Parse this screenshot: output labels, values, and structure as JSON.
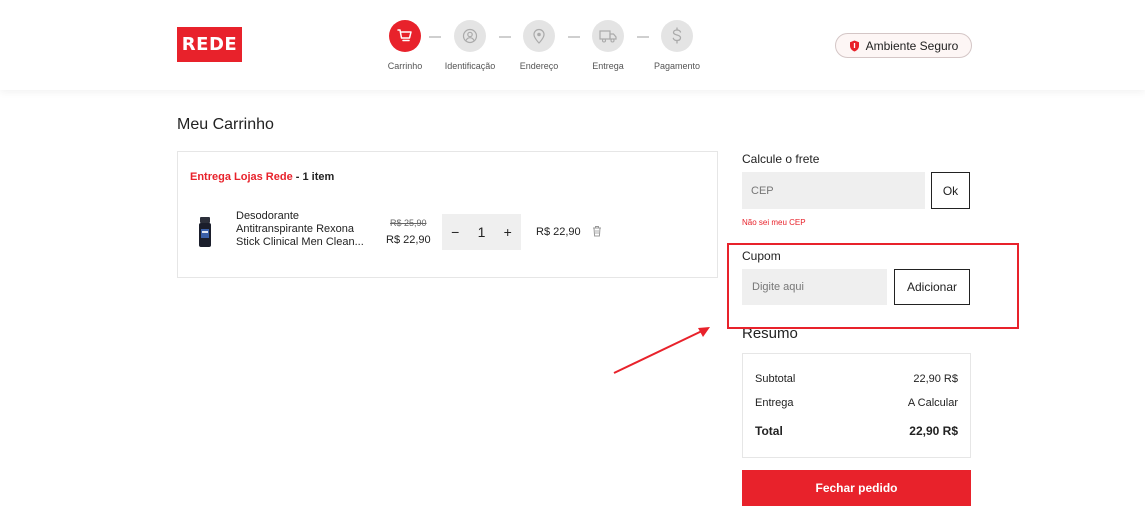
{
  "header": {
    "logo": "REDE",
    "secure_label": "Ambiente Seguro",
    "steps": [
      {
        "label": "Carrinho",
        "icon": "cart-icon",
        "active": true
      },
      {
        "label": "Identificação",
        "icon": "user-icon",
        "active": false
      },
      {
        "label": "Endereço",
        "icon": "location-pin-icon",
        "active": false
      },
      {
        "label": "Entrega",
        "icon": "truck-icon",
        "active": false
      },
      {
        "label": "Pagamento",
        "icon": "dollar-icon",
        "active": false
      }
    ]
  },
  "cart": {
    "title": "Meu Carrinho",
    "delivery_store": "Entrega Lojas Rede",
    "delivery_count": " - 1 item",
    "item": {
      "name": "Desodorante Antitranspirante Rexona Stick Clinical Men Clean...",
      "price_old": "R$ 25,90",
      "price_new": "R$ 22,90",
      "quantity": "1",
      "minus": "−",
      "plus": "+",
      "line_total": "R$ 22,90"
    }
  },
  "shipping": {
    "title": "Calcule o frete",
    "placeholder": "CEP",
    "ok_label": "Ok",
    "unknown_cep": "Não sei meu CEP"
  },
  "coupon": {
    "title": "Cupom",
    "placeholder": "Digite aqui",
    "add_label": "Adicionar"
  },
  "summary": {
    "title": "Resumo",
    "subtotal_label": "Subtotal",
    "subtotal_value": "22,90 R$",
    "delivery_label": "Entrega",
    "delivery_value": "A Calcular",
    "total_label": "Total",
    "total_value": "22,90 R$"
  },
  "checkout_label": "Fechar pedido",
  "colors": {
    "brand": "#e8222b",
    "step_inactive": "#e4e4e4",
    "input_bg": "#efefef"
  }
}
